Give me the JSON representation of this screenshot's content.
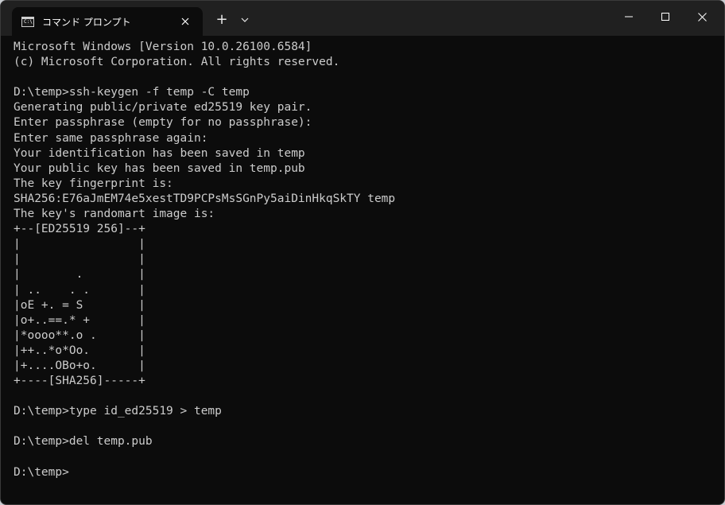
{
  "tab": {
    "title": "コマンド プロンプト",
    "icon": "cmd-icon",
    "icon_text": "C:\\"
  },
  "titlebar": {
    "new_tab_label": "+"
  },
  "terminal": {
    "lines": [
      "Microsoft Windows [Version 10.0.26100.6584]",
      "(c) Microsoft Corporation. All rights reserved.",
      "",
      "D:\\temp>ssh-keygen -f temp -C temp",
      "Generating public/private ed25519 key pair.",
      "Enter passphrase (empty for no passphrase):",
      "Enter same passphrase again:",
      "Your identification has been saved in temp",
      "Your public key has been saved in temp.pub",
      "The key fingerprint is:",
      "SHA256:E76aJmEM74e5xestTD9PCPsMsSGnPy5aiDinHkqSkTY temp",
      "The key's randomart image is:",
      "+--[ED25519 256]--+",
      "|                 |",
      "|                 |",
      "|        .        |",
      "| ..    . .       |",
      "|oE +. = S        |",
      "|o+..==.* +       |",
      "|*oooo**.o .      |",
      "|++..*o*Oo.       |",
      "|+....OBo+o.      |",
      "+----[SHA256]-----+",
      "",
      "D:\\temp>type id_ed25519 > temp",
      "",
      "D:\\temp>del temp.pub",
      "",
      "D:\\temp>"
    ]
  },
  "colors": {
    "background": "#0c0c0c",
    "titlebar": "#202020",
    "foreground": "#cccccc"
  }
}
